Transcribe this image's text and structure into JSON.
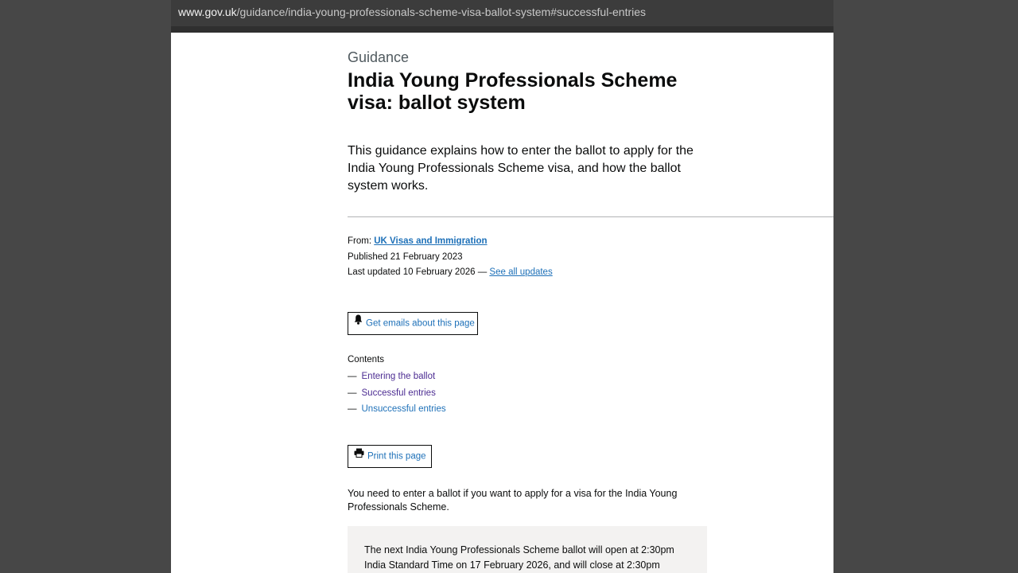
{
  "browser": {
    "url_domain": "www.gov.uk",
    "url_path": "/guidance/india-young-professionals-scheme-visa-ballot-system#successful-entries"
  },
  "header": {
    "caption": "Guidance",
    "title": "India Young Professionals Scheme visa: ballot system",
    "lead": "This guidance explains how to enter the ballot to apply for the India Young Professionals Scheme visa, and how the ballot system works."
  },
  "meta": {
    "from_label": "From:",
    "from_org": "UK Visas and Immigration",
    "published_label": "Published",
    "published_date": "21 February 2023",
    "updated_label": "Last updated",
    "updated_date": "10 February 2026",
    "updated_separator": "—",
    "see_updates": "See all updates"
  },
  "actions": {
    "emails_button": "Get emails about this page",
    "print_button": "Print this page"
  },
  "contents": {
    "heading": "Contents",
    "dash": "—",
    "items": [
      {
        "label": "Entering the ballot",
        "visited": true
      },
      {
        "label": "Successful entries",
        "visited": true
      },
      {
        "label": "Unsuccessful entries",
        "visited": false
      }
    ]
  },
  "body": {
    "intro": "You need to enter a ballot if you want to apply for a visa for the India Young Professionals Scheme.",
    "callout": "The next India Young Professionals Scheme ballot will open at 2:30pm India Standard Time on 17 February 2026, and will close at 2:30pm"
  },
  "colors": {
    "link": "#1d70b8",
    "visited": "#4c2c92",
    "text": "#0b0c0c",
    "callout_bg": "#f3f2f1",
    "backdrop": "#474747"
  }
}
